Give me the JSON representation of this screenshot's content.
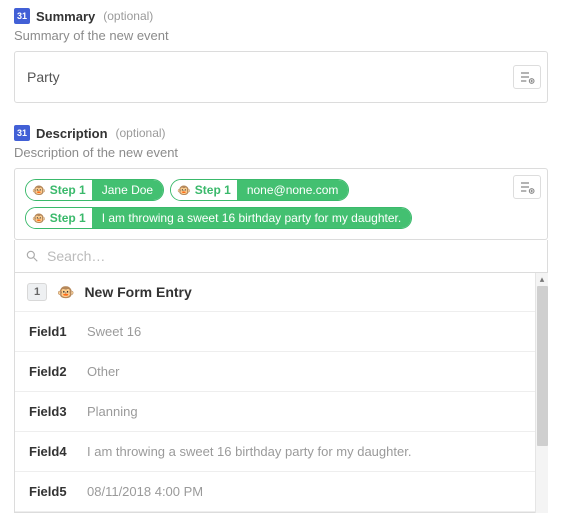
{
  "summary": {
    "title": "Summary",
    "optional": "(optional)",
    "subtitle": "Summary of the new event",
    "value": "Party"
  },
  "description": {
    "title": "Description",
    "optional": "(optional)",
    "subtitle": "Description of the new event",
    "pills": [
      {
        "step": "Step 1",
        "value": "Jane Doe"
      },
      {
        "step": "Step 1",
        "value": "none@none.com"
      },
      {
        "step": "Step 1",
        "value": "I am throwing a sweet 16 birthday party for my daughter."
      }
    ]
  },
  "search": {
    "placeholder": "Search…"
  },
  "group": {
    "number": "1",
    "title": "New Form Entry"
  },
  "fields": [
    {
      "name": "Field1",
      "value": "Sweet 16"
    },
    {
      "name": "Field2",
      "value": "Other"
    },
    {
      "name": "Field3",
      "value": "Planning"
    },
    {
      "name": "Field4",
      "value": "I am throwing a sweet 16 birthday party for my daughter."
    },
    {
      "name": "Field5",
      "value": "08/11/2018 4:00 PM"
    }
  ]
}
